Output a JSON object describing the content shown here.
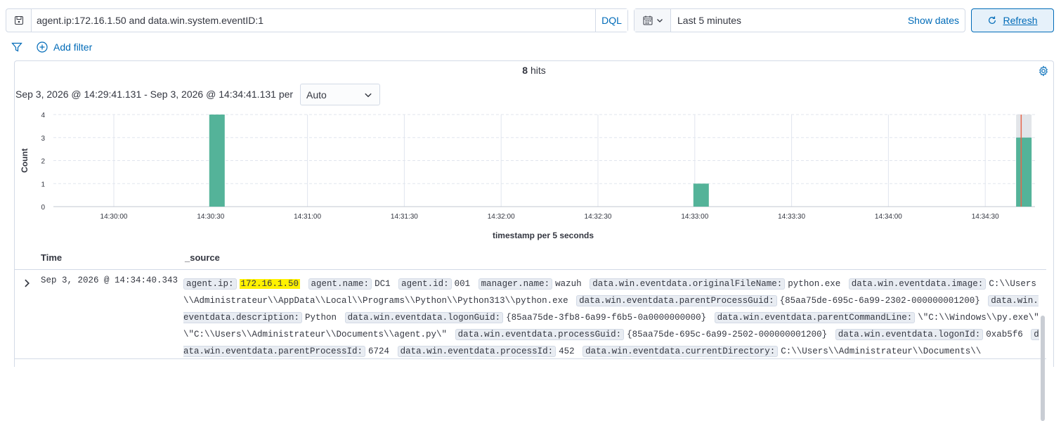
{
  "query": {
    "text": "agent.ip:172.16.1.50 and data.win.system.eventID:1",
    "language": "DQL"
  },
  "date": {
    "range_label": "Last 5 minutes",
    "show_dates": "Show dates",
    "refresh": "Refresh"
  },
  "filters": {
    "add_filter": "Add filter"
  },
  "hits": {
    "count": "8",
    "label": "hits"
  },
  "histogram": {
    "range": "Sep 3, 2026 @ 14:29:41.131 - Sep 3, 2026 @ 14:34:41.131 per",
    "interval": "Auto"
  },
  "chart_data": {
    "type": "bar",
    "title": "",
    "xlabel": "timestamp per 5 seconds",
    "ylabel": "Count",
    "ylim": [
      0,
      4
    ],
    "yticks": [
      "0",
      "1",
      "2",
      "3",
      "4"
    ],
    "xticks": [
      "14:30:00",
      "14:30:30",
      "14:31:00",
      "14:31:30",
      "14:32:00",
      "14:32:30",
      "14:33:00",
      "14:33:30",
      "14:34:00",
      "14:34:30"
    ],
    "bars": [
      {
        "x": "14:30:30",
        "value": 4
      },
      {
        "x": "14:33:00",
        "value": 1
      },
      {
        "x": "14:34:40",
        "value": 3,
        "partial_bucket": true
      }
    ],
    "bar_color": "#54b399",
    "now_marker": "14:34:41.131"
  },
  "table": {
    "columns": [
      "Time",
      "_source"
    ],
    "row": {
      "time": "Sep 3, 2026 @ 14:34:40.343",
      "fields": [
        {
          "k": "agent.ip:",
          "v": "172.16.1.50",
          "highlight": true
        },
        {
          "k": "agent.name:",
          "v": "DC1"
        },
        {
          "k": "agent.id:",
          "v": "001"
        },
        {
          "k": "manager.name:",
          "v": "wazuh"
        },
        {
          "k": "data.win.eventdata.originalFileName:",
          "v": "python.exe"
        },
        {
          "k": "data.win.eventdata.image:",
          "v": "C:\\\\Users\\\\Administrateur\\\\AppData\\\\Local\\\\Programs\\\\Python\\\\Python313\\\\python.exe"
        },
        {
          "k": "data.win.eventdata.parentProcessGuid:",
          "v": "{85aa75de-695c-6a99-2302-000000001200}"
        },
        {
          "k": "data.win.eventdata.description:",
          "v": "Python"
        },
        {
          "k": "data.win.eventdata.logonGuid:",
          "v": "{85aa75de-3fb8-6a99-f6b5-0a0000000000}"
        },
        {
          "k": "data.win.eventdata.parentCommandLine:",
          "v": "\\\"C:\\\\Windows\\\\py.exe\\\" \\\"C:\\\\Users\\\\Administrateur\\\\Documents\\\\agent.py\\\""
        },
        {
          "k": "data.win.eventdata.processGuid:",
          "v": "{85aa75de-695c-6a99-2502-000000001200}"
        },
        {
          "k": "data.win.eventdata.logonId:",
          "v": "0xab5f6"
        },
        {
          "k": "data.win.eventdata.parentProcessId:",
          "v": "6724"
        },
        {
          "k": "data.win.eventdata.processId:",
          "v": "452"
        },
        {
          "k": "data.win.eventdata.currentDirectory:",
          "v": "C:\\\\Users\\\\Administrateur\\\\Documents\\\\"
        }
      ]
    }
  },
  "colors": {
    "accent": "#006bb8",
    "highlight": "#fff100",
    "bar": "#54b399",
    "now_line": "#e7664c"
  }
}
